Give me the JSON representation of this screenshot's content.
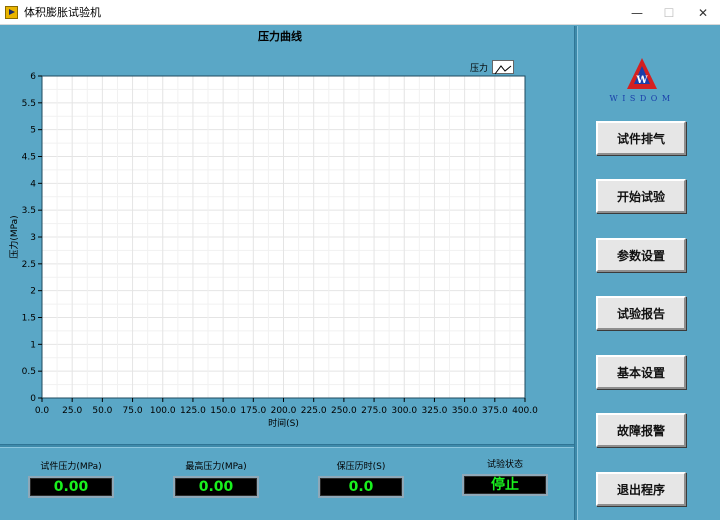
{
  "window": {
    "title": "体积膨胀试验机",
    "controls": {
      "minimize": "—",
      "maximize": "☐",
      "close": "✕"
    }
  },
  "chart": {
    "title": "压力曲线",
    "legend_label": "压力",
    "xlabel": "时间(S)",
    "ylabel": "压力(MPa)",
    "x_ticks": [
      "0.0",
      "25.0",
      "50.0",
      "75.0",
      "100.0",
      "125.0",
      "150.0",
      "175.0",
      "200.0",
      "225.0",
      "250.0",
      "275.0",
      "300.0",
      "325.0",
      "350.0",
      "375.0",
      "400.0"
    ],
    "y_ticks": [
      "0",
      "0.5",
      "1",
      "1.5",
      "2",
      "2.5",
      "3",
      "3.5",
      "4",
      "4.5",
      "5",
      "5.5",
      "6"
    ]
  },
  "chart_data": {
    "type": "line",
    "title": "压力曲线",
    "xlabel": "时间(S)",
    "ylabel": "压力(MPa)",
    "xlim": [
      0,
      400
    ],
    "ylim": [
      0,
      6
    ],
    "x_step": 25,
    "y_step": 0.5,
    "grid": true,
    "legend_placement": "top-right",
    "series": [
      {
        "name": "压力",
        "x": [],
        "values": []
      }
    ]
  },
  "logo": {
    "text": "WISDOM",
    "mark": "W"
  },
  "sidebar": {
    "buttons": [
      {
        "id": "vent",
        "label": "试件排气"
      },
      {
        "id": "start",
        "label": "开始试验"
      },
      {
        "id": "params",
        "label": "参数设置"
      },
      {
        "id": "report",
        "label": "试验报告"
      },
      {
        "id": "basic",
        "label": "基本设置"
      },
      {
        "id": "fault",
        "label": "故障报警"
      },
      {
        "id": "exit",
        "label": "退出程序"
      }
    ]
  },
  "indicators": [
    {
      "label": "试件压力(MPa)",
      "value": "0.00"
    },
    {
      "label": "最高压力(MPa)",
      "value": "0.00"
    },
    {
      "label": "保压历时(S)",
      "value": "0.0"
    },
    {
      "label": "试验状态",
      "value": "停止"
    }
  ],
  "colors": {
    "background": "#5aa7c6",
    "plot_background": "#ffffff",
    "grid": "#e4e4e4",
    "display_text": "#19f01e",
    "logo_red": "#d42020",
    "logo_blue": "#1a3faa"
  }
}
